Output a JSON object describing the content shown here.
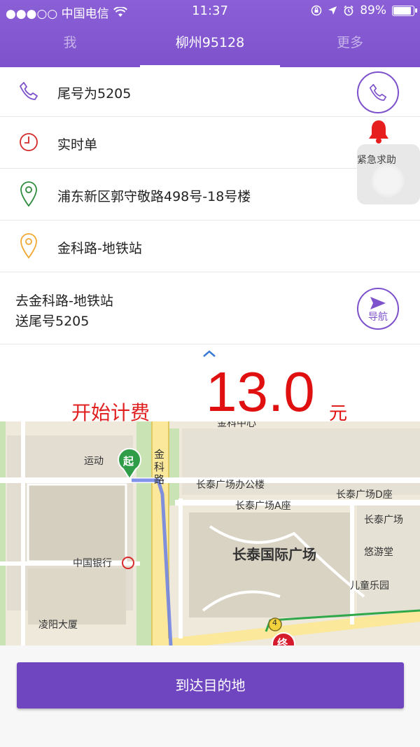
{
  "status_bar": {
    "carrier": "●●●○○ 中国电信",
    "time": "11:37",
    "battery": "89%",
    "battery_level": 0.89
  },
  "tabs": [
    {
      "label": "我",
      "active": false
    },
    {
      "label": "柳州95128",
      "active": true
    },
    {
      "label": "更多",
      "active": false
    }
  ],
  "order": {
    "tail_number": "尾号为5205",
    "order_type": "实时单",
    "pickup": "浦东新区郭守敬路498号-18号楼",
    "destination": "金科路-地铁站"
  },
  "navigation": {
    "line1": "去金科路-地铁站",
    "line2": "送尾号5205",
    "button_label": "导航"
  },
  "emergency": {
    "label": "紧急求助"
  },
  "fare": {
    "label": "开始计费",
    "amount": "13.0",
    "unit": "元"
  },
  "map": {
    "labels": {
      "jinke_center": "金科中心",
      "yundong": "运动",
      "road_jinke": "金科路",
      "changtai_office": "长泰广场办公楼",
      "changtai_d": "长泰广场D座",
      "changtai_a": "长泰广场A座",
      "changtai_e": "长泰广场",
      "changtai_intl": "长泰国际广场",
      "youyoutang": "悠游堂",
      "children_park": "儿童乐园",
      "bank_of_china": "中国银行",
      "lingyang": "凌阳大厦",
      "start_marker": "起",
      "end_marker": "终",
      "bus_stop": "4"
    }
  },
  "actions": {
    "arrive": "到达目的地"
  },
  "colors": {
    "brand_purple": "#7d52cc",
    "fare_red": "#e01010",
    "pickup_green": "#2e8b3d",
    "destination_orange": "#f0a830"
  }
}
